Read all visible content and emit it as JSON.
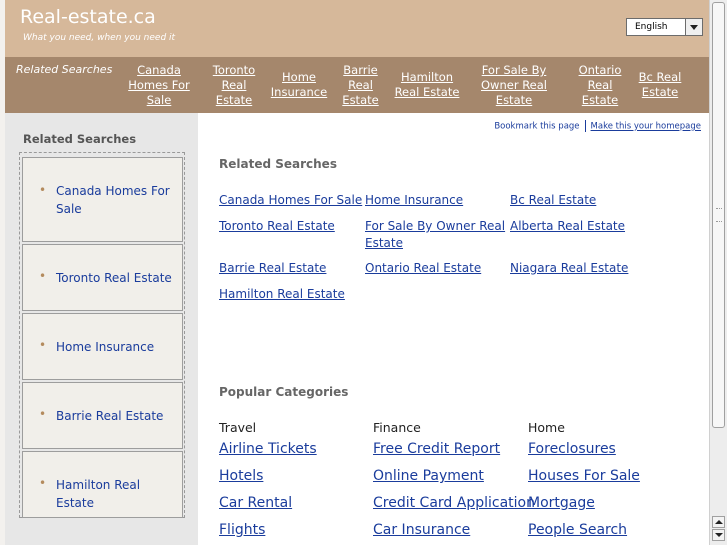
{
  "header": {
    "title": "Real-estate.ca",
    "tagline": "What you need, when you need it",
    "language": "English"
  },
  "nav": {
    "label": "Related Searches",
    "links": [
      "Canada Homes For Sale",
      "Toronto Real Estate",
      "Home Insurance",
      "Barrie Real Estate",
      "Hamilton Real Estate",
      "For Sale By Owner Real Estate",
      "Ontario Real Estate",
      "Bc Real Estate"
    ]
  },
  "sidebar": {
    "title": "Related Searches",
    "items": [
      "Canada Homes For Sale",
      "Toronto Real Estate",
      "Home Insurance",
      "Barrie Real Estate",
      "Hamilton Real Estate"
    ]
  },
  "main": {
    "bookmark": "Bookmark this page",
    "homepage": "Make this your homepage",
    "related_title": "Related Searches",
    "related_links": [
      "Canada Homes For Sale",
      "Home Insurance",
      "Bc Real Estate",
      "Toronto Real Estate",
      "For Sale By Owner Real Estate",
      "Alberta Real Estate",
      "Barrie Real Estate",
      "Ontario Real Estate",
      "Niagara Real Estate",
      "Hamilton Real Estate"
    ],
    "popular_title": "Popular Categories",
    "categories": [
      {
        "heading": "Travel",
        "links": [
          "Airline Tickets",
          "Hotels",
          "Car Rental",
          "Flights"
        ]
      },
      {
        "heading": "Finance",
        "links": [
          "Free Credit Report",
          "Online Payment",
          "Credit Card Application",
          "Car Insurance"
        ]
      },
      {
        "heading": "Home",
        "links": [
          "Foreclosures",
          "Houses For Sale",
          "Mortgage",
          "People Search"
        ]
      }
    ]
  },
  "colors": {
    "header_bg": "#d6b89a",
    "nav_bg": "#a5876c",
    "link": "#1a3c9c",
    "sidebar_bg": "#e7e7e7",
    "bullet": "#b48b5e"
  }
}
